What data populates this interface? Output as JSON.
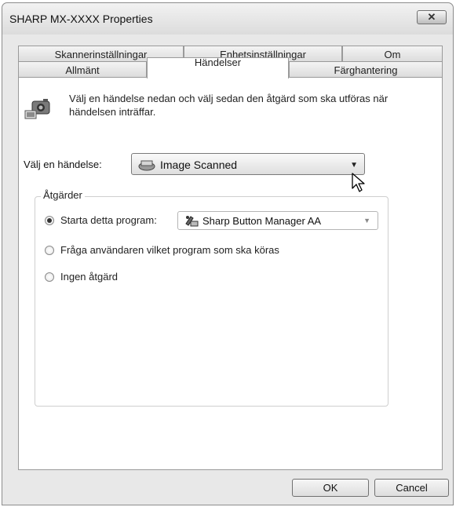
{
  "window": {
    "title": "SHARP MX-XXXX Properties",
    "close_symbol": "✕"
  },
  "tabs": {
    "row1": [
      {
        "label": "Skannerinställningar"
      },
      {
        "label": "Enhetsinställningar"
      },
      {
        "label": "Om"
      }
    ],
    "row2": [
      {
        "label": "Allmänt"
      },
      {
        "label": "Händelser",
        "active": true
      },
      {
        "label": "Färghantering"
      }
    ]
  },
  "events": {
    "description": "Välj en händelse nedan och välj sedan den åtgärd som ska utföras när händelsen inträffar.",
    "select_label": "Välj en händelse:",
    "selected_event": "Image Scanned"
  },
  "actions": {
    "group_label": "Åtgärder",
    "options": [
      {
        "label": "Starta detta program:",
        "checked": true
      },
      {
        "label": "Fråga användaren vilket program som ska köras",
        "checked": false
      },
      {
        "label": "Ingen åtgärd",
        "checked": false
      }
    ],
    "program": "Sharp Button Manager AA"
  },
  "buttons": {
    "ok": "OK",
    "cancel": "Cancel"
  },
  "colors": {
    "window_bg": "#e8e8e8",
    "panel_bg": "#ffffff",
    "border": "#9a9a9a"
  },
  "icons": {
    "scanner": "scanner-icon",
    "select_item": "image-scanned-icon",
    "program": "button-manager-icon",
    "dropdown": "chevron-down-icon",
    "cursor": "mouse-pointer-icon"
  }
}
